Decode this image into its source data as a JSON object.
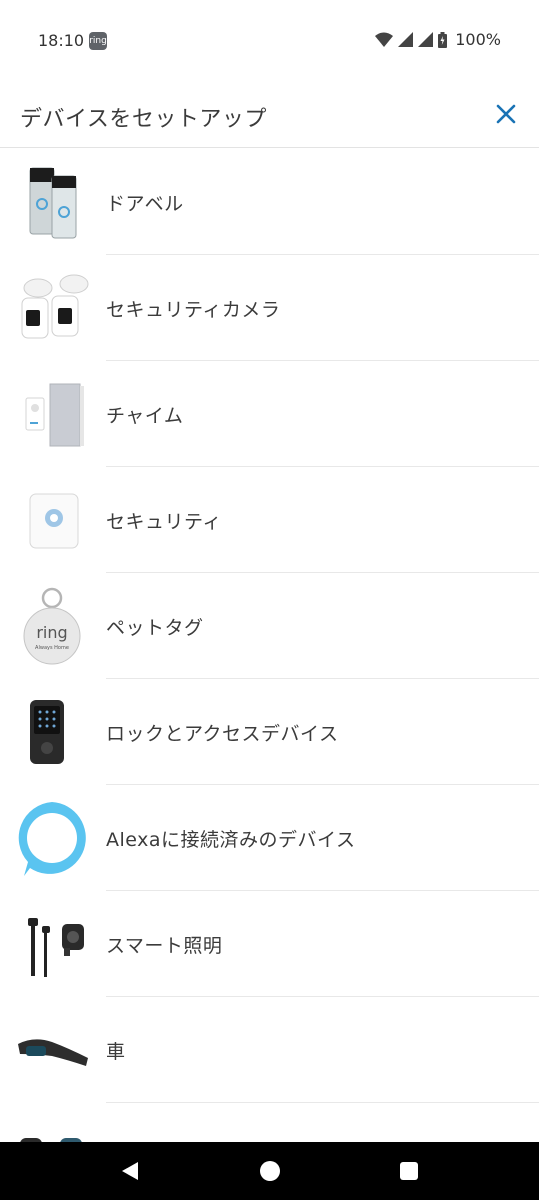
{
  "status_bar": {
    "time": "18:10",
    "app_badge": "ring",
    "battery": "100%"
  },
  "header": {
    "title": "デバイスをセットアップ",
    "close_icon": "close-icon",
    "accent_color": "#1a73b5"
  },
  "devices": [
    {
      "label": "ドアベル",
      "icon": "doorbell-icon"
    },
    {
      "label": "セキュリティカメラ",
      "icon": "floodlight-camera-icon"
    },
    {
      "label": "チャイム",
      "icon": "chime-icon"
    },
    {
      "label": "セキュリティ",
      "icon": "alarm-base-station-icon"
    },
    {
      "label": "ペットタグ",
      "icon": "pet-tag-icon",
      "tag_text": "ring",
      "tag_subtext": "Always Home"
    },
    {
      "label": "ロックとアクセスデバイス",
      "icon": "smart-lock-icon"
    },
    {
      "label": "Alexaに接続済みのデバイス",
      "icon": "alexa-icon"
    },
    {
      "label": "スマート照明",
      "icon": "smart-lighting-icon"
    },
    {
      "label": "車",
      "icon": "car-cam-icon"
    }
  ],
  "nav_bar": {
    "back": "back-triangle-icon",
    "home": "home-circle-icon",
    "recents": "recents-square-icon"
  }
}
